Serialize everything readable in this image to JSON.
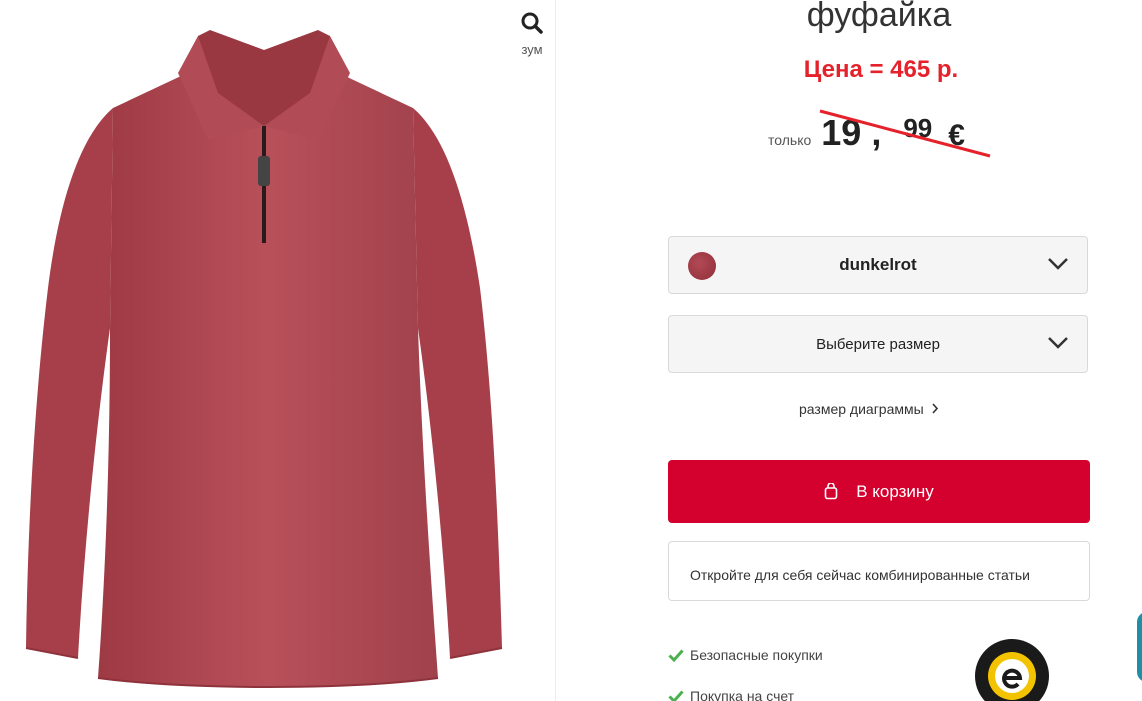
{
  "product": {
    "title": "фуфайка",
    "price_note": "Цена = 465 р.",
    "price_prefix": "только",
    "price_int": "19",
    "price_sep": ",",
    "price_cents": "99",
    "currency": "€"
  },
  "image": {
    "zoom_label": "зум",
    "color_hex": "#b4464f"
  },
  "options": {
    "color_value": "dunkelrot",
    "size_placeholder": "Выберите размер",
    "size_chart_label": "размер диаграммы"
  },
  "actions": {
    "cart_label": "В корзину",
    "combo_label": "Откройте для себя сейчас комбинированные статьи"
  },
  "trust": {
    "items": [
      "Безопасные покупки",
      "Покупка на счет"
    ]
  },
  "colors": {
    "accent": "#d4002e",
    "note_red": "#e5222b",
    "check_green": "#4caf50"
  }
}
